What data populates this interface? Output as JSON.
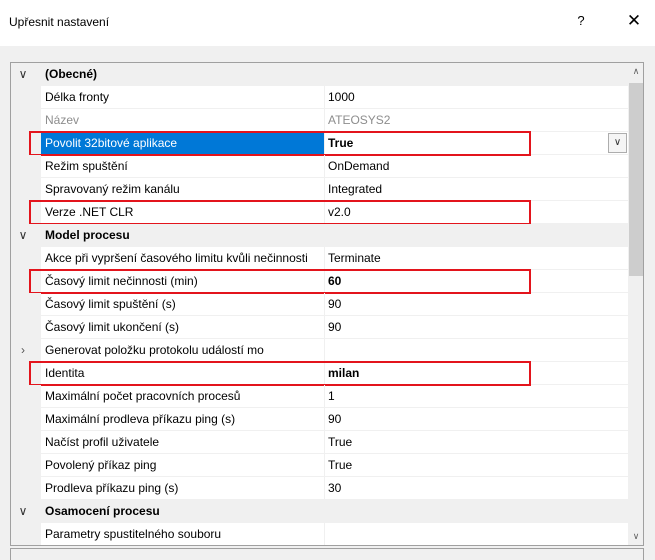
{
  "window": {
    "title": "Upřesnit nastavení",
    "help_label": "?",
    "close_label": "✕"
  },
  "properties": [
    {
      "kind": "category",
      "expanded": true,
      "name": "(Obecné)"
    },
    {
      "kind": "property",
      "name": "Délka fronty",
      "value": "1000"
    },
    {
      "kind": "property",
      "name": "Název",
      "value": "ATEOSYS2",
      "disabled": true
    },
    {
      "kind": "property",
      "name": "Povolit 32bitové aplikace",
      "value": "True",
      "selected": true,
      "bold": true,
      "highlighted": true,
      "has_dropdown": true
    },
    {
      "kind": "property",
      "name": "Režim spuštění",
      "value": "OnDemand"
    },
    {
      "kind": "property",
      "name": "Spravovaný režim kanálu",
      "value": "Integrated"
    },
    {
      "kind": "property",
      "name": "Verze .NET CLR",
      "value": "v2.0",
      "highlighted": true
    },
    {
      "kind": "category",
      "expanded": true,
      "name": "Model procesu"
    },
    {
      "kind": "property",
      "name": "Akce při vypršení časového limitu kvůli nečinnosti",
      "value": "Terminate"
    },
    {
      "kind": "property",
      "name": "Časový limit nečinnosti (min)",
      "value": "60",
      "bold": true,
      "highlighted": true
    },
    {
      "kind": "property",
      "name": "Časový limit spuštění (s)",
      "value": "90"
    },
    {
      "kind": "property",
      "name": "Časový limit ukončení (s)",
      "value": "90"
    },
    {
      "kind": "property",
      "name": "Generovat položku protokolu událostí mo",
      "value": "",
      "collapsible": true
    },
    {
      "kind": "property",
      "name": "Identita",
      "value": "milan",
      "bold": true,
      "highlighted": true
    },
    {
      "kind": "property",
      "name": "Maximální počet pracovních procesů",
      "value": "1"
    },
    {
      "kind": "property",
      "name": "Maximální prodleva příkazu ping (s)",
      "value": "90"
    },
    {
      "kind": "property",
      "name": "Načíst profil uživatele",
      "value": "True"
    },
    {
      "kind": "property",
      "name": "Povolený příkaz ping",
      "value": "True"
    },
    {
      "kind": "property",
      "name": "Prodleva příkazu ping (s)",
      "value": "30"
    },
    {
      "kind": "category",
      "expanded": true,
      "name": "Osamocení procesu"
    },
    {
      "kind": "property",
      "name": "Parametry spustitelného souboru",
      "value": ""
    }
  ],
  "glyphs": {
    "expanded": "∨",
    "collapsed": "›",
    "dropdown": "∨",
    "scroll_up": "∧",
    "scroll_down": "∨"
  },
  "colors": {
    "selection": "#0078d7",
    "highlight_box": "#e3141c",
    "disabled_text": "#8d8d8d"
  }
}
